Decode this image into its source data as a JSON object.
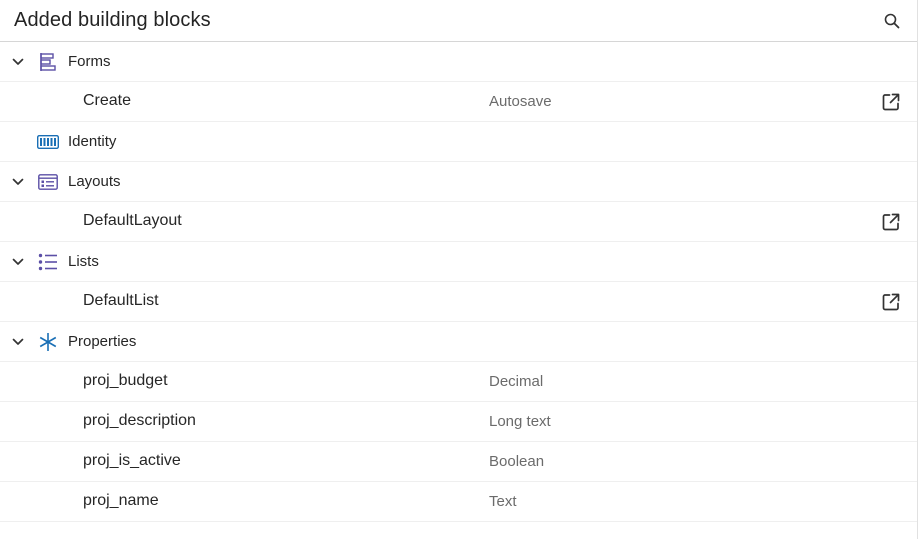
{
  "header": {
    "title": "Added building blocks",
    "search_icon": "search-icon"
  },
  "colors": {
    "icon_purple": "#5b4fa6",
    "icon_blue": "#1a6fb5",
    "text": "#262626",
    "muted": "#6b6b6b"
  },
  "rows": [
    {
      "kind": "category",
      "label": "Forms",
      "icon": "forms-icon",
      "expanded": true
    },
    {
      "kind": "child",
      "label": "Create",
      "meta": "Autosave",
      "open": true
    },
    {
      "kind": "category",
      "label": "Identity",
      "icon": "identity-icon",
      "expanded": false
    },
    {
      "kind": "category",
      "label": "Layouts",
      "icon": "layouts-icon",
      "expanded": true
    },
    {
      "kind": "child",
      "label": "DefaultLayout",
      "meta": "",
      "open": true
    },
    {
      "kind": "category",
      "label": "Lists",
      "icon": "lists-icon",
      "expanded": true
    },
    {
      "kind": "child",
      "label": "DefaultList",
      "meta": "",
      "open": true
    },
    {
      "kind": "category",
      "label": "Properties",
      "icon": "properties-icon",
      "expanded": true
    },
    {
      "kind": "child",
      "label": "proj_budget",
      "meta": "Decimal",
      "open": false
    },
    {
      "kind": "child",
      "label": "proj_description",
      "meta": "Long text",
      "open": false
    },
    {
      "kind": "child",
      "label": "proj_is_active",
      "meta": "Boolean",
      "open": false
    },
    {
      "kind": "child",
      "label": "proj_name",
      "meta": "Text",
      "open": false
    }
  ]
}
